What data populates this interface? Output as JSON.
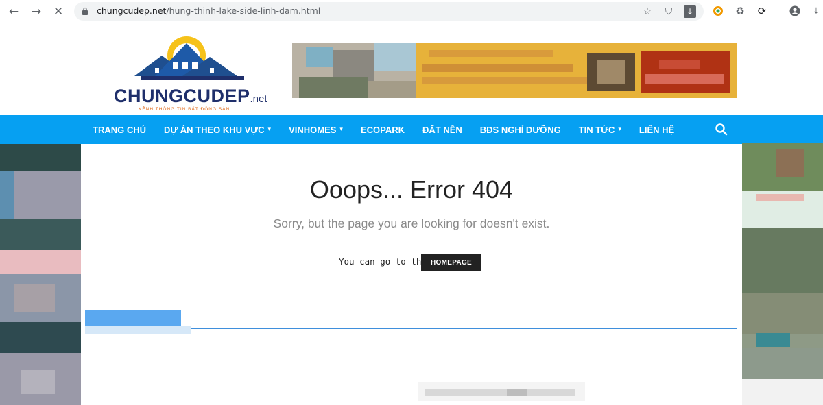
{
  "browser": {
    "url_domain": "chungcudep.net",
    "url_path": "/hung-thinh-lake-side-linh-dam.html",
    "icons": [
      "back-icon",
      "forward-icon",
      "stop-icon",
      "lock-icon",
      "star-icon",
      "shield-icon",
      "download-icon",
      "extension-icon",
      "recycle-icon",
      "sync-icon",
      "profile-icon",
      "download-tray-icon"
    ]
  },
  "site": {
    "logo_main": "CHUNGCUDEP",
    "logo_tld": ".net",
    "logo_slogan": "KÊNH THÔNG TIN BẤT ĐỘNG SẢN",
    "brand_color": "#06a0f2",
    "logo_color": "#1f2f6b",
    "nav": [
      {
        "label": "TRANG CHỦ",
        "dropdown": false
      },
      {
        "label": "DỰ ÁN THEO KHU VỰC",
        "dropdown": true
      },
      {
        "label": "VINHOMES",
        "dropdown": true
      },
      {
        "label": "ECOPARK",
        "dropdown": false
      },
      {
        "label": "ĐẤT NỀN",
        "dropdown": false
      },
      {
        "label": "BĐS NGHỈ DƯỠNG",
        "dropdown": false
      },
      {
        "label": "TIN TỨC",
        "dropdown": true
      },
      {
        "label": "LIÊN HỆ",
        "dropdown": false
      }
    ]
  },
  "error": {
    "title": "Ooops... Error 404",
    "subtitle": "Sorry, but the page you are looking for doesn't exist.",
    "goto_text": "You can go to the",
    "homepage_button": "HOMEPAGE"
  },
  "chevron": "▾"
}
